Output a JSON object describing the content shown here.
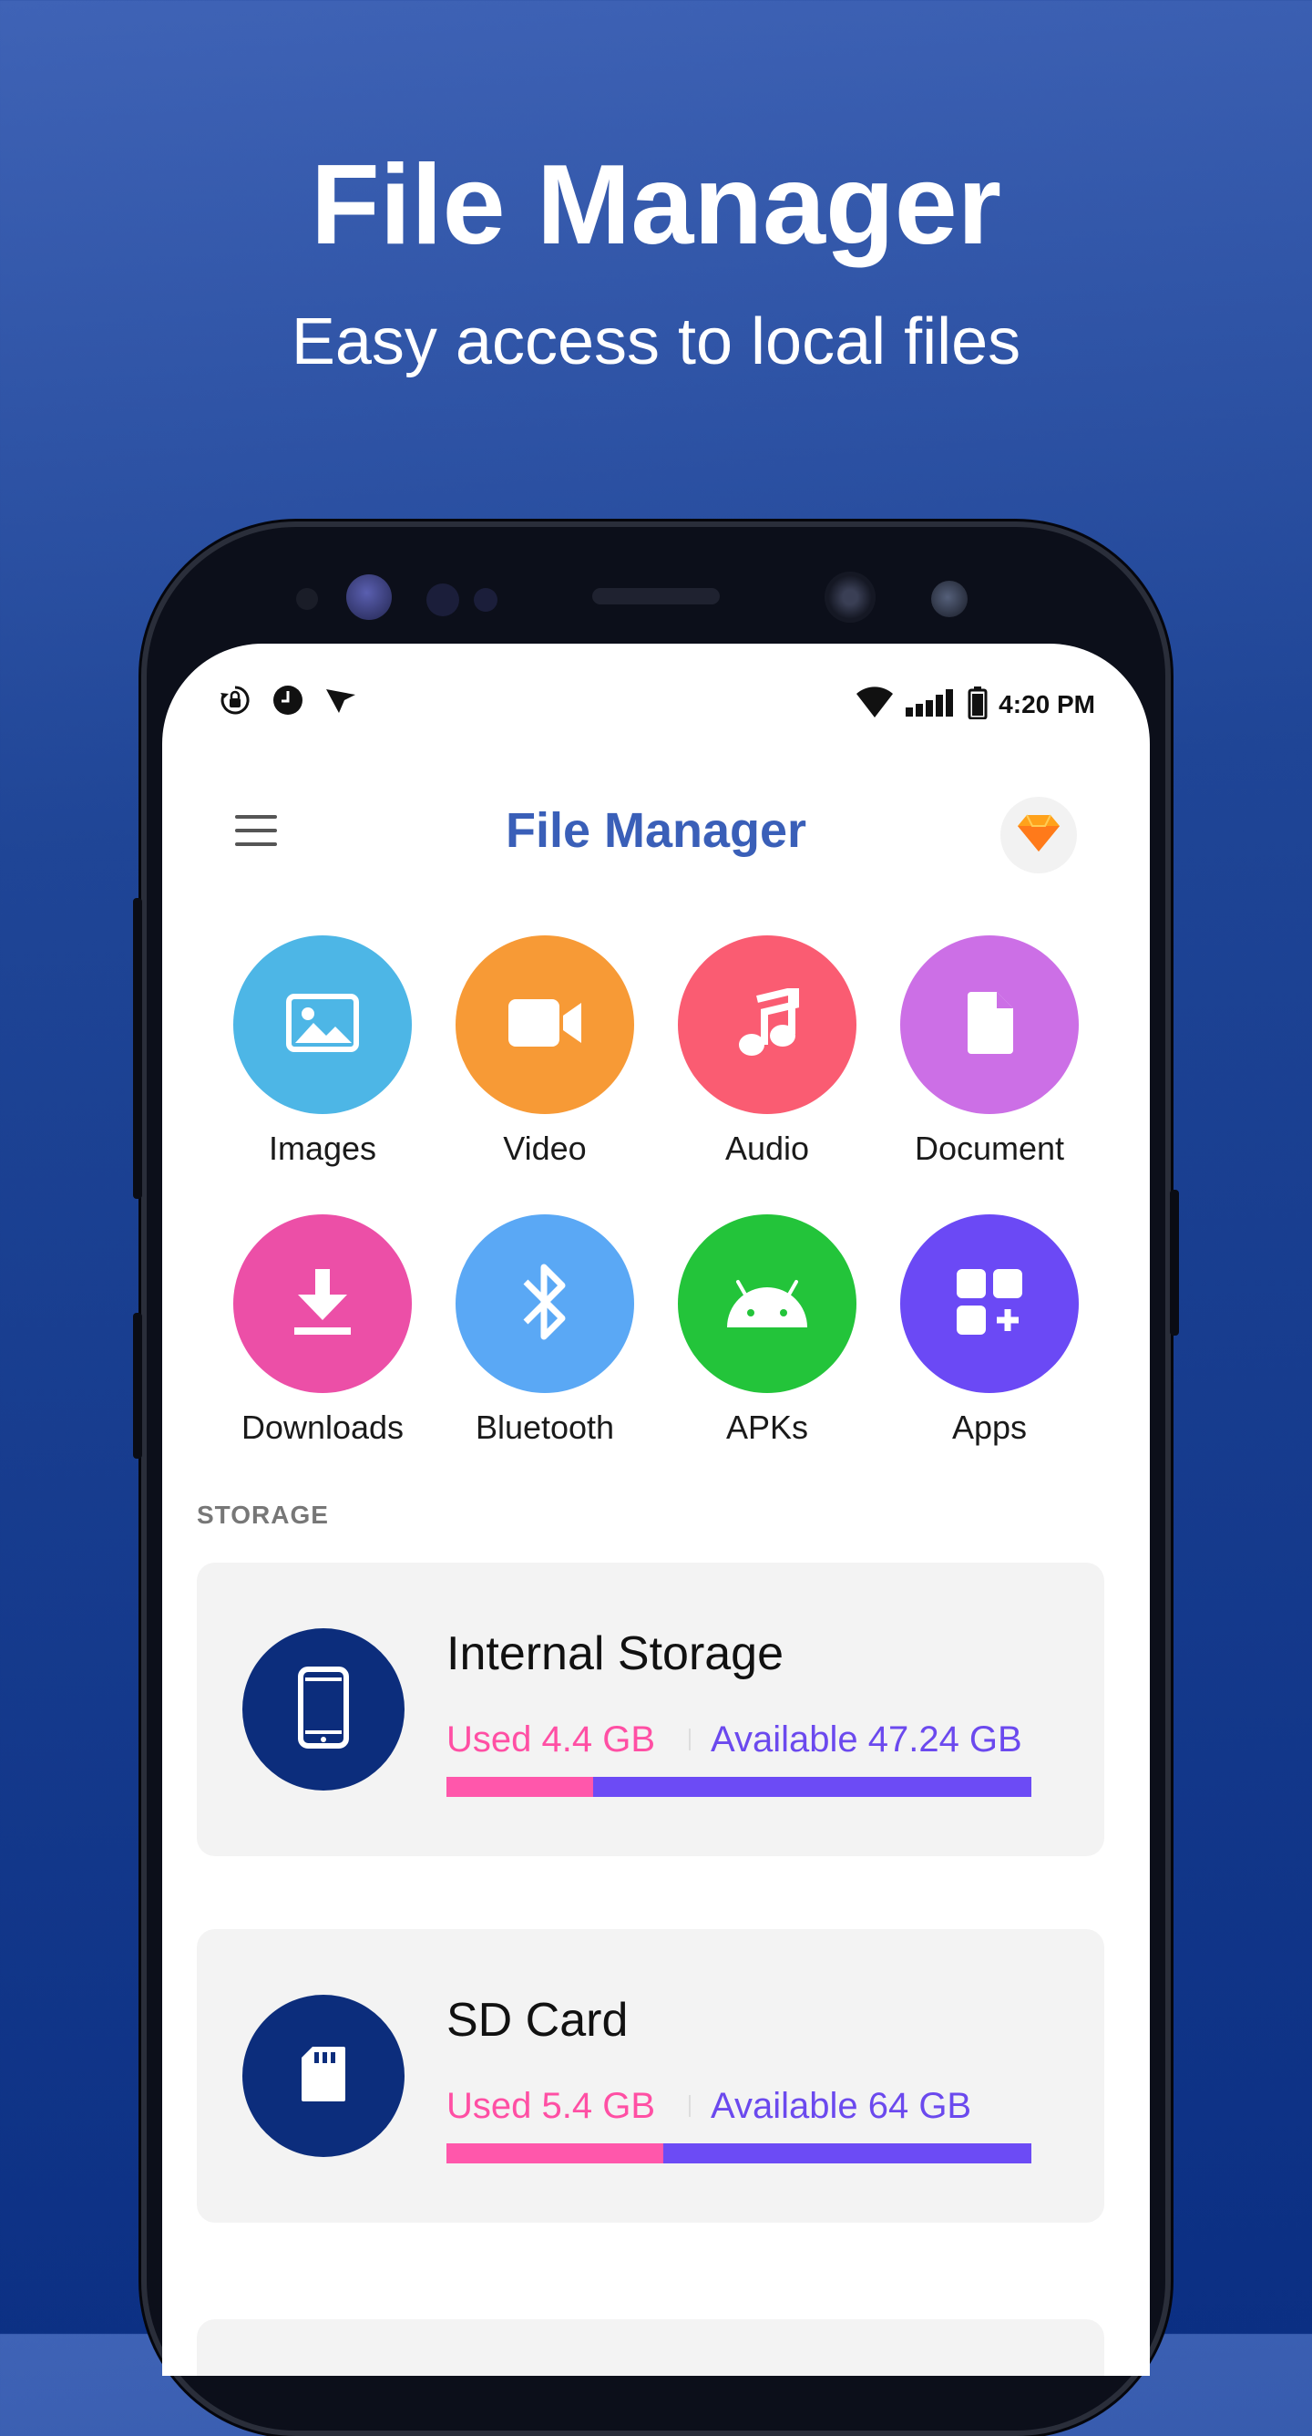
{
  "promo": {
    "title": "File Manager",
    "subtitle": "Easy access to local files"
  },
  "status_bar": {
    "time": "4:20 PM",
    "left_icons": [
      "sync-lock-icon",
      "clock-icon",
      "navigation-arrow-icon"
    ],
    "right_icons": [
      "wifi-icon",
      "signal-icon",
      "battery-icon"
    ]
  },
  "app_bar": {
    "title": "File Manager",
    "menu_icon": "hamburger-menu-icon",
    "premium_icon": "diamond-icon"
  },
  "categories": [
    {
      "label": "Images",
      "icon": "image-icon",
      "color": "#4db6e6"
    },
    {
      "label": "Video",
      "icon": "video-camera-icon",
      "color": "#f79a36"
    },
    {
      "label": "Audio",
      "icon": "music-note-icon",
      "color": "#fa5c72"
    },
    {
      "label": "Document",
      "icon": "document-icon",
      "color": "#cc6fe6"
    },
    {
      "label": "Downloads",
      "icon": "download-icon",
      "color": "#ec4fa7"
    },
    {
      "label": "Bluetooth",
      "icon": "bluetooth-icon",
      "color": "#5aa8f5"
    },
    {
      "label": "APKs",
      "icon": "android-icon",
      "color": "#23c43a"
    },
    {
      "label": "Apps",
      "icon": "apps-add-icon",
      "color": "#6b49f5"
    }
  ],
  "storage": {
    "section_label": "STORAGE",
    "items": [
      {
        "name": "Internal Storage",
        "used": "Used 4.4 GB",
        "available": "Available 47.24 GB",
        "icon": "smartphone-icon",
        "used_fraction": 0.25
      },
      {
        "name": "SD Card",
        "used": "Used 5.4 GB",
        "available": "Available 64 GB",
        "icon": "sd-card-icon",
        "used_fraction": 0.37
      }
    ]
  },
  "colors": {
    "used": "#ff4fa4",
    "available": "#6b49ee",
    "storage_icon_bg": "#0c2d7c",
    "title_blue": "#3a5fb8"
  }
}
